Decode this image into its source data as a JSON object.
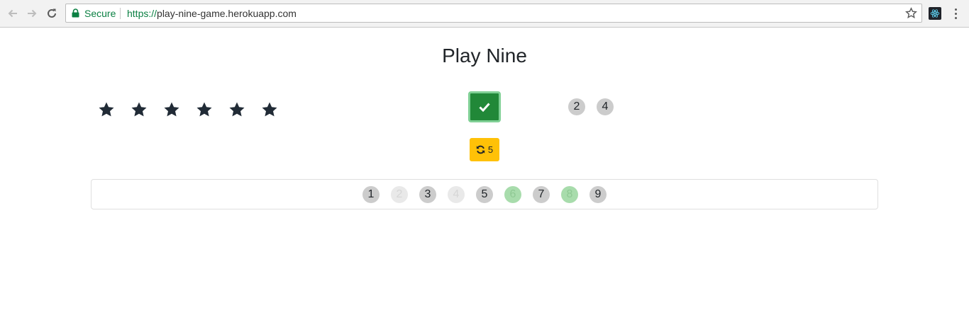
{
  "browser": {
    "secure_label": "Secure",
    "url_scheme": "https://",
    "url_host": "play-nine-game.herokuapp.com"
  },
  "page": {
    "title": "Play Nine"
  },
  "stars": {
    "count": 6,
    "color": "#212b36"
  },
  "answer": {
    "state": "correct",
    "check_color": "#218838"
  },
  "selected_numbers": [
    "2",
    "4"
  ],
  "redraw": {
    "remaining": "5",
    "color": "#ffc107"
  },
  "numbers": [
    {
      "label": "1",
      "status": "available"
    },
    {
      "label": "2",
      "status": "used"
    },
    {
      "label": "3",
      "status": "available"
    },
    {
      "label": "4",
      "status": "used"
    },
    {
      "label": "5",
      "status": "available"
    },
    {
      "label": "6",
      "status": "selected"
    },
    {
      "label": "7",
      "status": "available"
    },
    {
      "label": "8",
      "status": "selected"
    },
    {
      "label": "9",
      "status": "available"
    }
  ]
}
